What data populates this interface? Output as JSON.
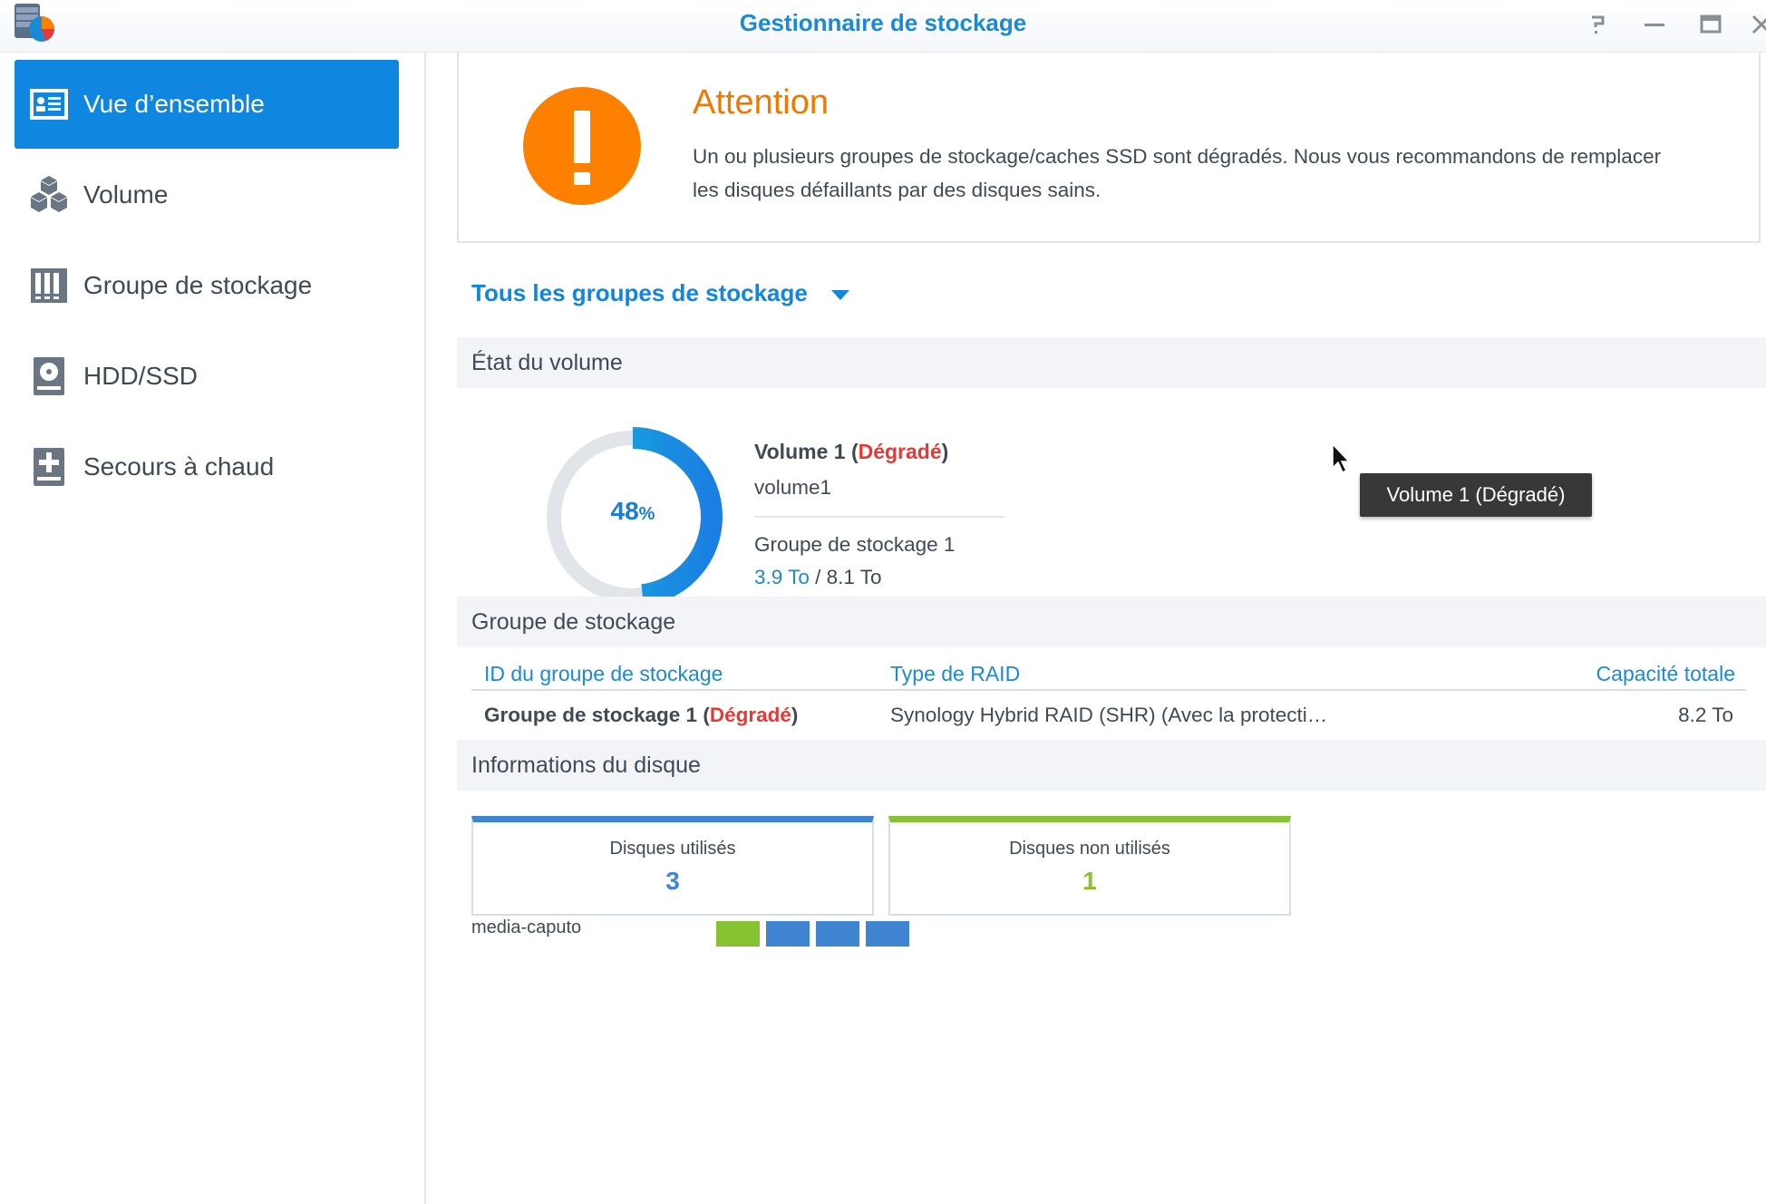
{
  "window": {
    "title": "Gestionnaire de stockage",
    "icons": {
      "app": "storage-manager-app-icon",
      "help": "help-icon",
      "minimize": "minimize-icon",
      "maximize": "maximize-icon",
      "close": "close-icon"
    }
  },
  "sidebar": {
    "items": [
      {
        "label": "Vue d’ensemble",
        "icon": "overview-icon",
        "active": true
      },
      {
        "label": "Volume",
        "icon": "cubes-icon",
        "active": false
      },
      {
        "label": "Groupe de stockage",
        "icon": "storage-pool-icon",
        "active": false
      },
      {
        "label": "HDD/SSD",
        "icon": "disk-icon",
        "active": false
      },
      {
        "label": "Secours à chaud",
        "icon": "hot-spare-icon",
        "active": false
      }
    ]
  },
  "alert": {
    "title": "Attention",
    "message": "Un ou plusieurs groupes de stockage/caches SSD sont dégradés. Nous vous recommandons de remplacer les disques défaillants par des disques sains.",
    "icon": "warning-icon",
    "color": "#fd8000"
  },
  "group_selector": {
    "label": "Tous les groupes de stockage"
  },
  "volume_section": {
    "header": "État du volume",
    "usage_percent": 48,
    "usage_number": "48",
    "usage_unit": "%",
    "volume_title": "Volume 1",
    "status_open": "(",
    "status": "Dégradé",
    "status_close": ")",
    "volume_name": "volume1",
    "group": "Groupe de stockage 1",
    "used": "3.9 To",
    "separator": " / ",
    "total": "8.1 To",
    "tooltip": "Volume 1 (Dégradé)"
  },
  "pool_section": {
    "header": "Groupe de stockage",
    "columns": [
      "ID du groupe de stockage",
      "Type de RAID",
      "Capacité totale"
    ],
    "rows": [
      {
        "id": "Groupe de stockage 1",
        "status_open": " (",
        "status": "Dégradé",
        "status_close": ")",
        "raid": "Synology Hybrid RAID (SHR) (Avec la protecti…",
        "capacity": "8.2 To"
      }
    ]
  },
  "disk_section": {
    "header": "Informations du disque",
    "used_label": "Disques utilisés",
    "used_count": "3",
    "unused_label": "Disques non utilisés",
    "unused_count": "1",
    "nas_name": "media-caputo",
    "slots": [
      "unused",
      "used",
      "used",
      "used"
    ],
    "colors": {
      "used": "#3e84d1",
      "unused": "#86c232"
    }
  }
}
